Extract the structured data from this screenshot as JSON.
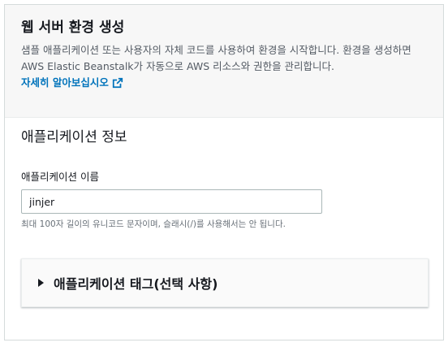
{
  "header": {
    "title": "웹 서버 환경 생성",
    "description": "샘플 애플리케이션 또는 사용자의 자체 코드를 사용하여 환경을 시작합니다. 환경을 생성하면 AWS Elastic Beanstalk가 자동으로 AWS 리소스와 권한을 관리합니다.",
    "learn_more": "자세히 알아보십시오",
    "link_color": "#0073bb",
    "link_icon": "external-link-icon"
  },
  "section": {
    "title": "애플리케이션 정보",
    "app_name_label": "애플리케이션 이름",
    "app_name_value": "jinjer",
    "app_name_hint": "최대 100자 길이의 유니코드 문자이며, 슬래시(/)를 사용해서는 안 됩니다."
  },
  "tags_expander": {
    "label": "애플리케이션 태그(선택 사항)",
    "icon": "caret-right-icon",
    "expanded": false
  }
}
